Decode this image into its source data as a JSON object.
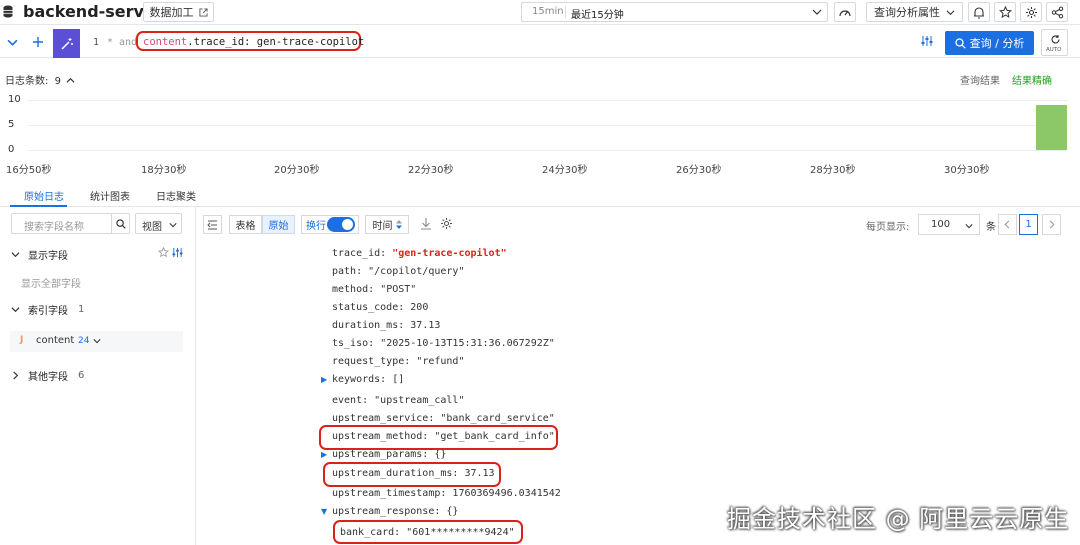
{
  "app": {
    "title": "backend-server"
  },
  "topbar": {
    "data_process_label": "数据加工",
    "time_short": "15min",
    "time_label": "最近15分钟",
    "query_attr_label": "查询分析属性"
  },
  "query": {
    "line_no": "1",
    "star": "*",
    "and": "and",
    "keyword": "content",
    "text": ".trace_id: gen-trace-copilot",
    "submit_label": "查询 / 分析",
    "auto_label": "AUTO"
  },
  "histogram": {
    "count_label": "日志条数:",
    "count_value": "9",
    "result_label": "查询结果",
    "precise_label": "结果精确"
  },
  "chart_data": {
    "type": "bar",
    "y_ticks": [
      "10",
      "5",
      "0"
    ],
    "ylim": [
      0,
      10
    ],
    "x_ticks": [
      "16分50秒",
      "18分30秒",
      "20分30秒",
      "22分30秒",
      "24分30秒",
      "26分30秒",
      "28分30秒",
      "30分30秒"
    ],
    "values": [
      9
    ],
    "color": "#8cc868"
  },
  "tabs": [
    "原始日志",
    "统计图表",
    "日志聚类"
  ],
  "sidebar": {
    "search_placeholder": "搜索字段名称",
    "view_label": "视图",
    "shown_fields_label": "显示字段",
    "show_all_label": "显示全部字段",
    "index_fields_label": "索引字段",
    "index_fields_count": "1",
    "field": {
      "type_badge": "J",
      "name": "content",
      "count": "24"
    },
    "other_fields_label": "其他字段",
    "other_fields_count": "6"
  },
  "toolbar": {
    "table_label": "表格",
    "raw_label": "原始",
    "wrap_label": "换行",
    "time_label": "时间",
    "per_page_label": "每页显示:",
    "per_page_value": "100",
    "per_page_unit": "条",
    "page": "1"
  },
  "log": {
    "trace_id_key": "trace_id:",
    "trace_id_val": "\"gen-trace-copilot\"",
    "lines": [
      {
        "k": "path:",
        "v": "\"/copilot/query\""
      },
      {
        "k": "method:",
        "v": "\"POST\""
      },
      {
        "k": "status_code:",
        "v": "200"
      },
      {
        "k": "duration_ms:",
        "v": "37.13"
      },
      {
        "k": "ts_iso:",
        "v": "\"2025-10-13T15:31:36.067292Z\""
      },
      {
        "k": "request_type:",
        "v": "\"refund\""
      },
      {
        "k": "keywords:",
        "v": "[]"
      },
      {
        "k": "event:",
        "v": "\"upstream_call\""
      },
      {
        "k": "upstream_service:",
        "v": "\"bank_card_service\""
      },
      {
        "k": "upstream_method:",
        "v": "\"get_bank_card_info\""
      },
      {
        "k": "upstream_params:",
        "v": "{}"
      },
      {
        "k": "upstream_duration_ms:",
        "v": "37.13"
      },
      {
        "k": "upstream_timestamp:",
        "v": "1760369496.0341542"
      },
      {
        "k": "upstream_response:",
        "v": "{}"
      },
      {
        "k": "bank_card:",
        "v": "\"601*********9424\""
      }
    ]
  },
  "watermark": "掘金技术社区 @ 阿里云云原生"
}
